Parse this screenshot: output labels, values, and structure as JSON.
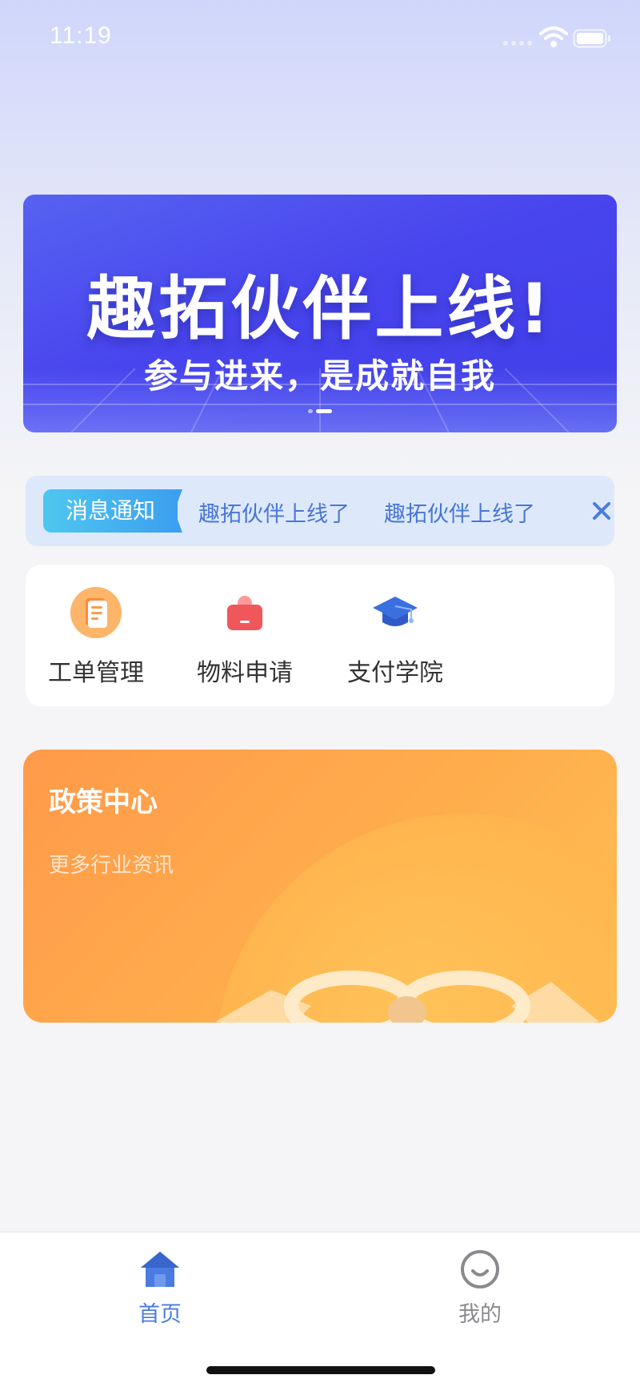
{
  "status_bar": {
    "time": "11:19"
  },
  "banner": {
    "title": "趣拓伙伴上线!",
    "subtitle": "参与进来，是成就自我",
    "slide_count": 2,
    "active_slide": 2
  },
  "notice": {
    "tag": "消息通知",
    "messages": [
      "趣拓伙伴上线了",
      "趣拓伙伴上线了"
    ]
  },
  "quick_menu": {
    "items": [
      {
        "label": "工单管理",
        "icon": "work-order-icon"
      },
      {
        "label": "物料申请",
        "icon": "material-bag-icon"
      },
      {
        "label": "支付学院",
        "icon": "graduation-cap-icon"
      }
    ]
  },
  "policy_card": {
    "title": "政策中心",
    "subtitle": "更多行业资讯"
  },
  "tab_bar": {
    "tabs": [
      {
        "label": "首页",
        "icon": "home-icon",
        "active": true
      },
      {
        "label": "我的",
        "icon": "smile-face-icon",
        "active": false
      }
    ]
  },
  "colors": {
    "accent_blue": "#4a7be0",
    "banner_blue": "#4845ee",
    "policy_orange": "#ffad4c",
    "notice_bg": "#dde9fb"
  }
}
